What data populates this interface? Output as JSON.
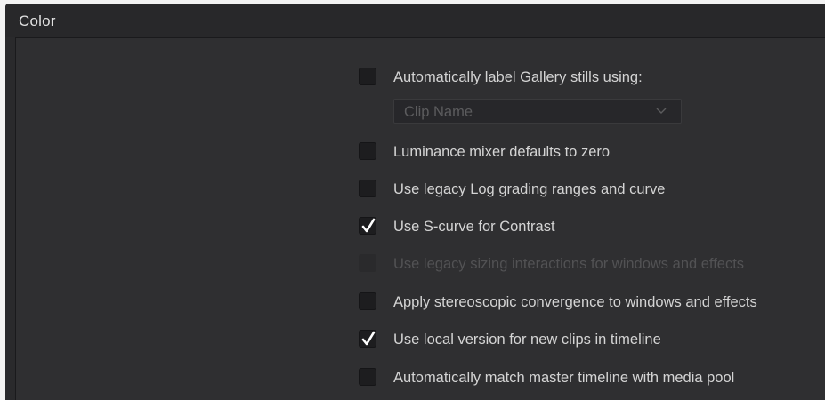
{
  "section": {
    "title": "Color"
  },
  "gallery_label": {
    "label": "Automatically label Gallery stills using:",
    "checked": false,
    "dropdown": {
      "value": "Clip Name",
      "icon": "chevron-down-icon"
    }
  },
  "options": [
    {
      "label": "Luminance mixer defaults to zero",
      "checked": false,
      "enabled": true
    },
    {
      "label": "Use legacy Log grading ranges and curve",
      "checked": false,
      "enabled": true
    },
    {
      "label": "Use S-curve for Contrast",
      "checked": true,
      "enabled": true
    },
    {
      "label": "Use legacy sizing interactions for windows and effects",
      "checked": false,
      "enabled": false
    },
    {
      "label": "Apply stereoscopic convergence to windows and effects",
      "checked": false,
      "enabled": true
    },
    {
      "label": "Use local version for new clips in timeline",
      "checked": true,
      "enabled": true
    },
    {
      "label": "Automatically match master timeline with media pool",
      "checked": false,
      "enabled": true
    }
  ],
  "colors": {
    "background": "#2a2a2c",
    "panel": "#2f2f31",
    "checkbox": "#1d1d1f",
    "text": "#d4d4d4",
    "disabled_text": "#525254",
    "checkmark": "#ffffff"
  }
}
